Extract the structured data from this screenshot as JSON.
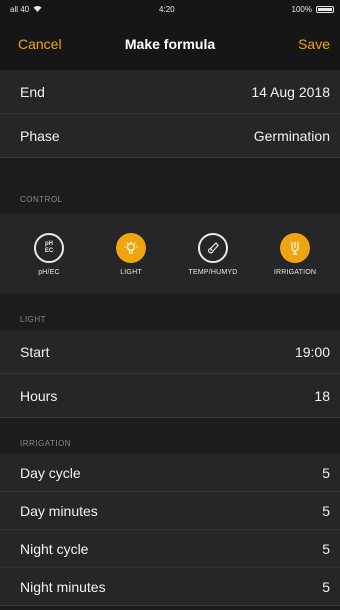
{
  "status_bar": {
    "signal": "all 40",
    "time": "4:20",
    "battery": "100%"
  },
  "nav": {
    "cancel_label": "Cancel",
    "title": "Make formula",
    "save_label": "Save"
  },
  "info": {
    "end_label": "End",
    "end_value": "14 Aug 2018",
    "phase_label": "Phase",
    "phase_value": "Germination"
  },
  "control": {
    "header": "CONTROL",
    "items": [
      {
        "label": "pH/EC",
        "icon": "ph-ec-icon",
        "state": "off",
        "icon_text_top": "pH",
        "icon_text_bottom": "EC"
      },
      {
        "label": "LIGHT",
        "icon": "light-bulb-icon",
        "state": "on"
      },
      {
        "label": "TEMP/HUMYD",
        "icon": "thermometer-icon",
        "state": "off"
      },
      {
        "label": "IRRIGATION",
        "icon": "irrigation-icon",
        "state": "on"
      }
    ]
  },
  "light": {
    "header": "LIGHT",
    "start_label": "Start",
    "start_value": "19:00",
    "hours_label": "Hours",
    "hours_value": "18"
  },
  "irrigation": {
    "header": "IRRIGATION",
    "rows": [
      {
        "label": "Day cycle",
        "value": "5"
      },
      {
        "label": "Day minutes",
        "value": "5"
      },
      {
        "label": "Night cycle",
        "value": "5"
      },
      {
        "label": "Night minutes",
        "value": "5"
      }
    ]
  },
  "colors": {
    "accent": "#f0a50e",
    "background": "#1c1c1e",
    "row_background": "#262628"
  }
}
